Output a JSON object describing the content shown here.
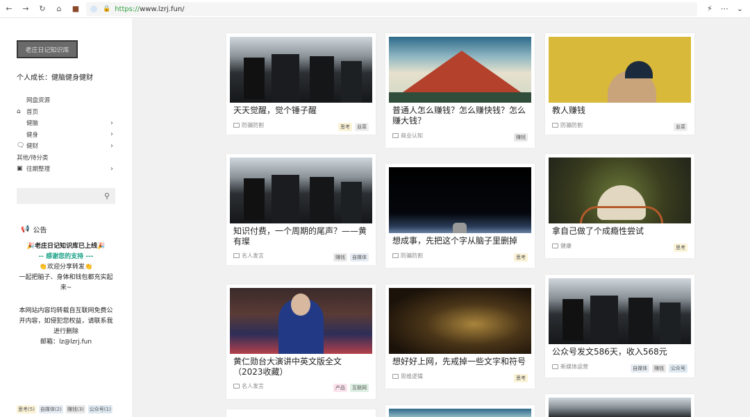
{
  "browser": {
    "url_protocol": "https://",
    "url_host": "www.lzrj.fun/"
  },
  "sidebar": {
    "site_button": "老庄日记知识库",
    "tagline": "个人成长：健脑健身健财",
    "menu": [
      {
        "label": "网盘资源",
        "icon": "",
        "indent": true,
        "chevron": false
      },
      {
        "label": "首页",
        "icon": "home-icon",
        "indent": false,
        "chevron": false
      },
      {
        "label": "健脑",
        "icon": "",
        "indent": true,
        "chevron": true
      },
      {
        "label": "健身",
        "icon": "",
        "indent": true,
        "chevron": true
      },
      {
        "label": "健财",
        "icon": "chat-icon",
        "indent": false,
        "chevron": true
      },
      {
        "label": "其他/待分类",
        "icon": "",
        "indent": false,
        "chevron": false
      },
      {
        "label": "往期整理",
        "icon": "archive-icon",
        "indent": false,
        "chevron": true
      }
    ],
    "notice_title": "公告",
    "notice_lines": {
      "l1": "🎉老庄日记知识库已上线🎉",
      "l2": "-- 感谢您的支持 ---",
      "l3": "👏欢迎分享转发👏",
      "l4": "一起把脑子、身体和钱包都充实起来~",
      "l5": "本网站内容均转载自互联网免费公开内容，如侵犯您权益，请联系我进行删除",
      "l6": "邮箱：lz@lzrj.fun"
    },
    "tags": [
      "思考(5)",
      "自媒体(2)",
      "赚钱(3)",
      "公众号(1)"
    ]
  },
  "cards": [
    {
      "title": "天天觉醒，觉个锤子醒",
      "category": "防骗防割",
      "badges": [
        "思考",
        "韭菜"
      ]
    },
    {
      "title": "普通人怎么赚钱？怎么赚快钱？怎么赚大钱？",
      "category": "商业认知",
      "badges": [
        "赚钱"
      ]
    },
    {
      "title": "教人赚钱",
      "category": "防骗防割",
      "badges": [
        "韭菜"
      ]
    },
    {
      "title": "知识付费，一个周期的尾声？——黄有璨",
      "category": "名人发言",
      "badges": [
        "赚钱",
        "自媒体"
      ]
    },
    {
      "title": "想成事，先把这个字从脑子里删掉",
      "category": "防骗防割",
      "badges": [
        "思考"
      ]
    },
    {
      "title": "拿自己做了个成瘾性尝试",
      "category": "健康",
      "badges": [
        "思考"
      ]
    },
    {
      "title": "黄仁勋台大演讲中英文版全文（2023收藏）",
      "category": "名人发言",
      "badges": [
        "产品",
        "互联网"
      ]
    },
    {
      "title": "想好好上网，先戒掉一些文字和符号",
      "category": "思维逻辑",
      "badges": [
        "思考"
      ]
    },
    {
      "title": "公众号发文586天，收入568元",
      "category": "新媒体运营",
      "badges": [
        "自媒体",
        "赚钱",
        "公众号"
      ]
    }
  ]
}
